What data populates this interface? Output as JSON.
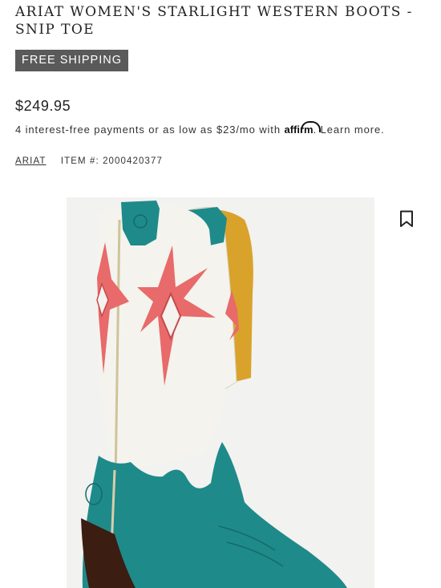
{
  "product": {
    "title": "ARIAT WOMEN'S STARLIGHT WESTERN BOOTS - SNIP TOE",
    "badge": "FREE SHIPPING",
    "price": "$249.95",
    "financing": {
      "text": "4 interest-free payments or as low as $23/mo with",
      "provider": "affirm",
      "link": "Learn more."
    },
    "brand": "ARIAT",
    "item_number_label": "ITEM #: 2000420377"
  },
  "icons": {
    "bookmark": "bookmark-icon"
  },
  "colors": {
    "badge_bg": "#5a5a5a",
    "boot_teal": "#1f8a8a",
    "boot_white": "#f4f3ee",
    "star_coral": "#e86a6a",
    "lining_mustard": "#d9a22b"
  }
}
